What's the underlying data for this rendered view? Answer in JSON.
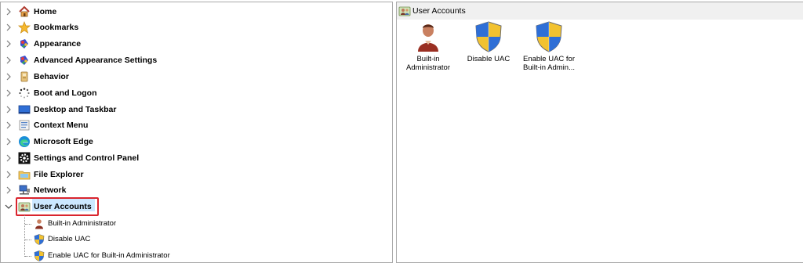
{
  "tree": {
    "nodes": [
      {
        "label": "Home",
        "icon": "home-icon"
      },
      {
        "label": "Bookmarks",
        "icon": "star-icon"
      },
      {
        "label": "Appearance",
        "icon": "palette-icon"
      },
      {
        "label": "Advanced Appearance Settings",
        "icon": "palette-icon"
      },
      {
        "label": "Behavior",
        "icon": "behavior-icon"
      },
      {
        "label": "Boot and Logon",
        "icon": "boot-spinner-icon"
      },
      {
        "label": "Desktop and Taskbar",
        "icon": "desktop-icon"
      },
      {
        "label": "Context Menu",
        "icon": "context-menu-icon"
      },
      {
        "label": "Microsoft Edge",
        "icon": "edge-icon"
      },
      {
        "label": "Settings and Control Panel",
        "icon": "gear-icon"
      },
      {
        "label": "File Explorer",
        "icon": "folder-icon"
      },
      {
        "label": "Network",
        "icon": "network-icon"
      },
      {
        "label": "User Accounts",
        "icon": "user-accounts-icon"
      }
    ],
    "children": [
      {
        "label": "Built-in Administrator",
        "icon": "user-icon"
      },
      {
        "label": "Disable UAC",
        "icon": "uac-shield-icon"
      },
      {
        "label": "Enable UAC for Built-in Administrator",
        "icon": "uac-shield-icon"
      }
    ],
    "selected": "User Accounts"
  },
  "list": {
    "title": "User Accounts",
    "items": [
      {
        "label_line1": "Built-in",
        "label_line2": "Administrator",
        "icon": "user-icon"
      },
      {
        "label_line1": "Disable UAC",
        "label_line2": "",
        "icon": "uac-shield-icon"
      },
      {
        "label_line1": "Enable UAC for",
        "label_line2": "Built-in Admin...",
        "icon": "uac-shield-icon"
      }
    ]
  },
  "colors": {
    "selection_border": "#d9252e",
    "selection_fill": "#cce8ff",
    "pane_border": "#a9a9a9",
    "header_bg": "#f0f0f0"
  }
}
